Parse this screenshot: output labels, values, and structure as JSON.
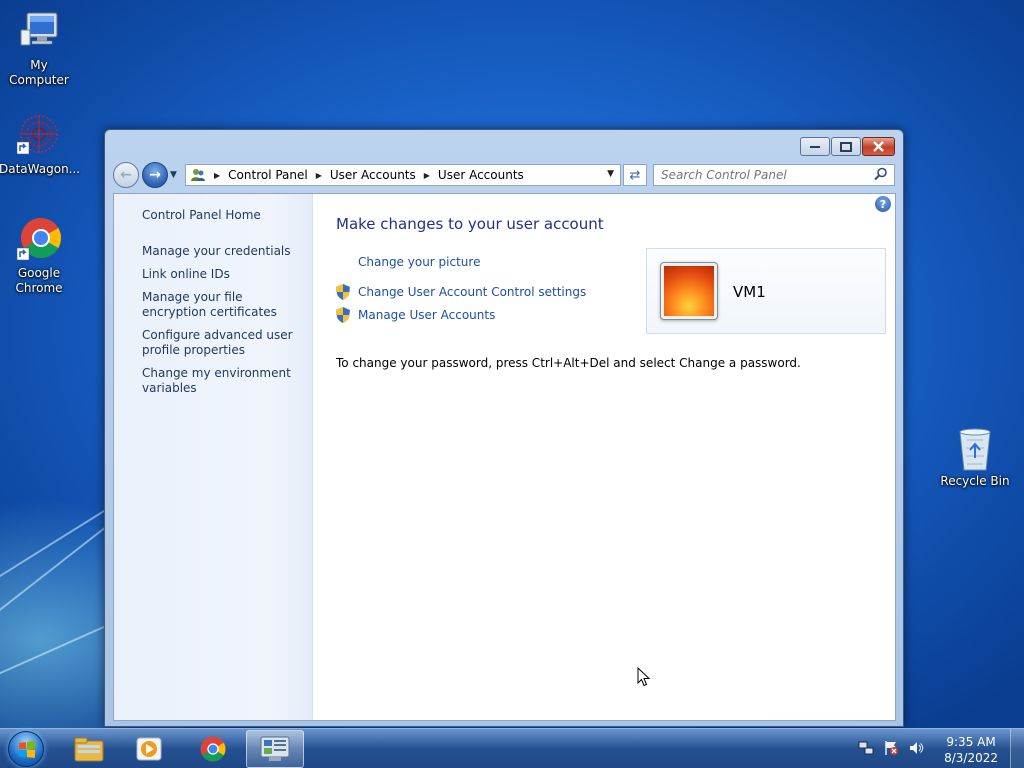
{
  "desktop": {
    "icons": [
      {
        "label": "My Computer",
        "icon": "computer-icon"
      },
      {
        "label": "DataWagon...",
        "icon": "datawagon-icon"
      },
      {
        "label": "Google Chrome",
        "icon": "chrome-icon"
      },
      {
        "label": "Recycle Bin",
        "icon": "recycle-bin-icon"
      }
    ]
  },
  "window": {
    "breadcrumb": [
      "Control Panel",
      "User Accounts",
      "User Accounts"
    ],
    "search_placeholder": "Search Control Panel",
    "left_pane": {
      "home": "Control Panel Home",
      "items": [
        "Manage your credentials",
        "Link online IDs",
        "Manage your file encryption certificates",
        "Configure advanced user profile properties",
        "Change my environment variables"
      ]
    },
    "main": {
      "heading": "Make changes to your user account",
      "tasks": [
        {
          "label": "Change your picture",
          "shield": false
        },
        {
          "label": "Change User Account Control settings",
          "shield": true
        },
        {
          "label": "Manage User Accounts",
          "shield": true
        }
      ],
      "account_name": "VM1",
      "password_note": "To change your password, press Ctrl+Alt+Del and select Change a password."
    }
  },
  "taskbar": {
    "pinned": [
      "explorer-icon",
      "media-player-icon",
      "chrome-icon",
      "control-panel-icon"
    ],
    "active": "control-panel-icon",
    "tray_icons": [
      "network-icon",
      "action-center-icon",
      "volume-icon"
    ],
    "time": "9:35 AM",
    "date": "8/3/2022"
  },
  "colors": {
    "link": "#1d4fa3",
    "heading": "#1e3287",
    "left_pane_text": "#1e395b",
    "desktop": "#1a63c9"
  }
}
